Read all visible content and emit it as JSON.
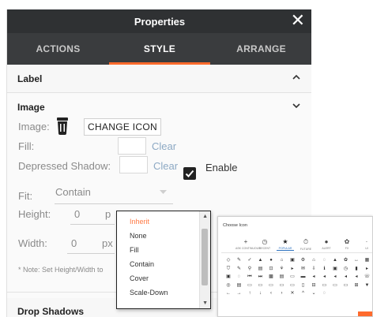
{
  "header": {
    "title": "Properties",
    "close_glyph": "✕"
  },
  "tabs": [
    {
      "label": "ACTIONS"
    },
    {
      "label": "STYLE",
      "active": true
    },
    {
      "label": "ARRANGE"
    }
  ],
  "sections": {
    "label": {
      "title": "Label",
      "state": "collapsed"
    },
    "image": {
      "title": "Image",
      "state": "expanded"
    },
    "drop_shadows": {
      "title": "Drop Shadows"
    }
  },
  "image_section": {
    "image_label": "Image:",
    "current_icon": "trash-can-icon",
    "change_icon_button": "CHANGE ICON",
    "fill_label": "Fill:",
    "fill_clear": "Clear",
    "depressed_label": "Depressed Shadow:",
    "depressed_clear": "Clear",
    "enable_label": "Enable",
    "enable_checked": true,
    "fit_label": "Fit:",
    "fit_value": "Contain",
    "height_label": "Height:",
    "height_value": "0",
    "height_unit": "p",
    "width_label": "Width:",
    "width_value": "0",
    "width_unit": "px",
    "note": "* Note: Set Height/Width to"
  },
  "fit_options": [
    {
      "label": "Inherit",
      "selected": true
    },
    {
      "label": "None"
    },
    {
      "label": "Fill"
    },
    {
      "label": "Contain"
    },
    {
      "label": "Cover"
    },
    {
      "label": "Scale-Down"
    }
  ],
  "icon_chooser": {
    "title": "Choose Icon",
    "categories": [
      {
        "label": "ASK CONTINUOUS",
        "glyph": "+"
      },
      {
        "label": "RECENT",
        "glyph": "◷"
      },
      {
        "label": "POPULAR",
        "glyph": "★",
        "active": true
      },
      {
        "label": "FUTURE",
        "glyph": "⏱"
      },
      {
        "label": "ALERT",
        "glyph": "●"
      },
      {
        "label": "FX",
        "glyph": "✿"
      },
      {
        "label": "UI",
        "glyph": "·"
      }
    ],
    "grid": [
      [
        "◇",
        "✎",
        "✓",
        "▲",
        "●",
        "⌂",
        "▣",
        "⚙",
        "⌂",
        "◌",
        "▲",
        "✿",
        "↔",
        "▦"
      ],
      [
        "⛉",
        "✎",
        "⚲",
        "▤",
        "⊡",
        "⚘",
        "▸",
        "✉",
        "⇩",
        "ℹ",
        "▣",
        "◷",
        "▮",
        "▸"
      ],
      [
        "▣",
        "◌",
        "⏮",
        "⏭",
        "▩",
        "▤",
        "▭",
        "▬",
        "◂",
        "◂",
        "◂",
        "◂",
        "◂",
        "☏"
      ],
      [
        "◎",
        "▤",
        "▭",
        "▭",
        "▭",
        "▭",
        "▭",
        "▯",
        "⊟",
        "▭",
        "▭",
        "▭",
        "⊞",
        "▼"
      ],
      [
        "←",
        "→",
        "↑",
        "↓",
        "‹",
        "›",
        "✕",
        "^",
        "⌄",
        "◌"
      ]
    ]
  },
  "colors": {
    "header_bg": "#2f3133",
    "tabs_bg": "#3a3c3e",
    "accent": "#ff6a2c",
    "link": "#8da9c4",
    "selected_option": "#ff7a45"
  }
}
